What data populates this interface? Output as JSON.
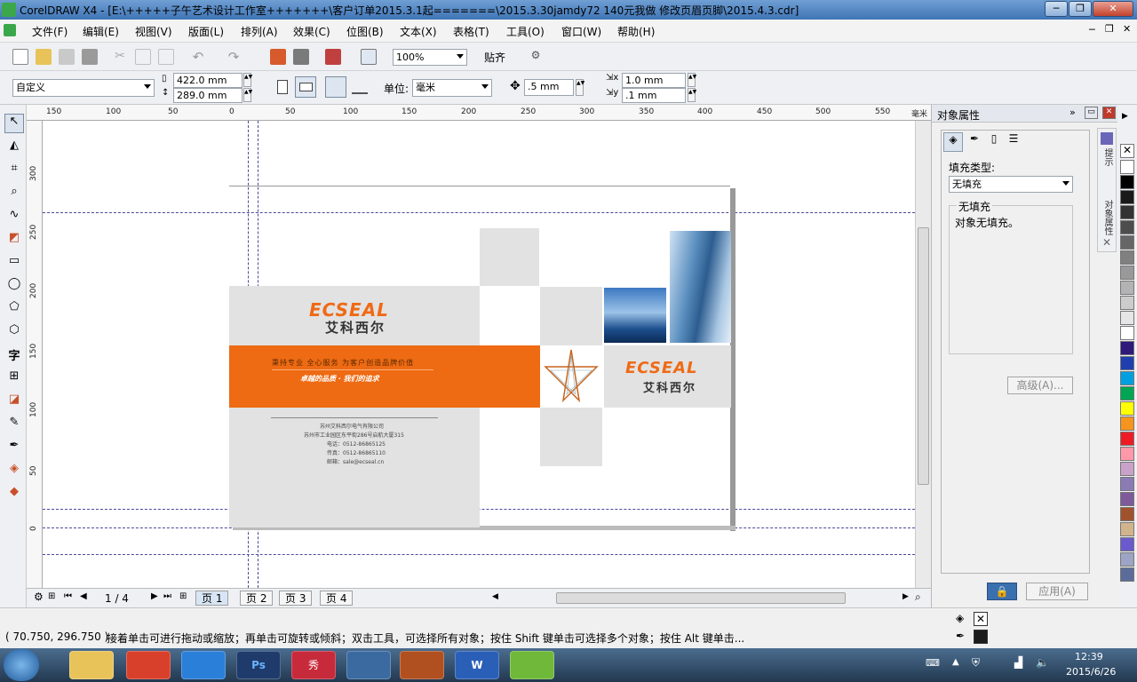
{
  "window": {
    "title": "CorelDRAW X4 - [E:\\+++++子午艺术设计工作室+++++++\\客户订单2015.3.1起=======\\2015.3.30jamdy72  140元我做 修改页眉页脚\\2015.4.3.cdr]",
    "minimize": "─",
    "restore": "❐",
    "close": "✕"
  },
  "menu": [
    "文件(F)",
    "编辑(E)",
    "视图(V)",
    "版面(L)",
    "排列(A)",
    "效果(C)",
    "位图(B)",
    "文本(X)",
    "表格(T)",
    "工具(O)",
    "窗口(W)",
    "帮助(H)"
  ],
  "toolbar": {
    "zoom": "100%",
    "snap": "贴齐"
  },
  "propbar": {
    "paper": "自定义",
    "width": "422.0 mm",
    "height": "289.0 mm",
    "unit_label": "单位:",
    "unit": "毫米",
    "nudge": ".5 mm",
    "dup_x": "1.0 mm",
    "dup_y": ".1 mm"
  },
  "ruler": {
    "h_labels": [
      "150",
      "100",
      "50",
      "0",
      "50",
      "100",
      "150",
      "200",
      "250",
      "300",
      "350",
      "400",
      "450",
      "500",
      "550",
      "毫米"
    ],
    "v_labels": [
      "300",
      "250",
      "200",
      "150",
      "100",
      "50",
      "0"
    ]
  },
  "pages": {
    "current": "1 / 4",
    "tabs": [
      "页 1",
      "页 2",
      "页 3",
      "页 4"
    ]
  },
  "design": {
    "brand": "ECSEAL",
    "brand_cn": "艾科西尔",
    "slogan1": "秉持专业 全心服务 为客户创造品牌价值",
    "slogan2": "卓越的品质 · 我们的追求",
    "company": "苏州艾科西尔电气有限公司",
    "address": "苏州市工业园区东平街286号启航大厦315",
    "tel": "电话：0512-86865125",
    "fax": "传真：0512-86865110",
    "email": "邮箱：sale@ecseal.cn"
  },
  "docker": {
    "title": "对象属性",
    "fill_type_label": "填充类型:",
    "fill_type": "无填充",
    "group_label": "无填充",
    "desc": "对象无填充。",
    "advanced": "高级(A)...",
    "apply": "应用(A)",
    "side_tab1": "提示",
    "side_tab2": "对象属性"
  },
  "status": {
    "coords": "( 70.750, 296.750 )",
    "hint": "接着单击可进行拖动或缩放；再单击可旋转或倾斜；双击工具，可选择所有对象；按住 Shift 键单击可选择多个对象；按住 Alt 键单击..."
  },
  "taskbar": {
    "time": "12:39",
    "date": "2015/6/26"
  },
  "palette": [
    "#ffffff",
    "#000000",
    "#1a1a1a",
    "#333333",
    "#4d4d4d",
    "#666666",
    "#808080",
    "#999999",
    "#b3b3b3",
    "#cccccc",
    "#e6e6e6",
    "#ffffff",
    "#2e1a7a",
    "#1f3fb0",
    "#00a0e0",
    "#00a651",
    "#ffff00",
    "#f7941d",
    "#ed1c24",
    "#ff99aa",
    "#c8a2c8",
    "#8b7bb5",
    "#7e5a9b",
    "#a0522d",
    "#d2b48c",
    "#6a5acd",
    "#9ea4c6",
    "#5b6c9a"
  ],
  "colors": {
    "accent": "#ee6a13",
    "panel_gray": "#e2e2e2"
  }
}
